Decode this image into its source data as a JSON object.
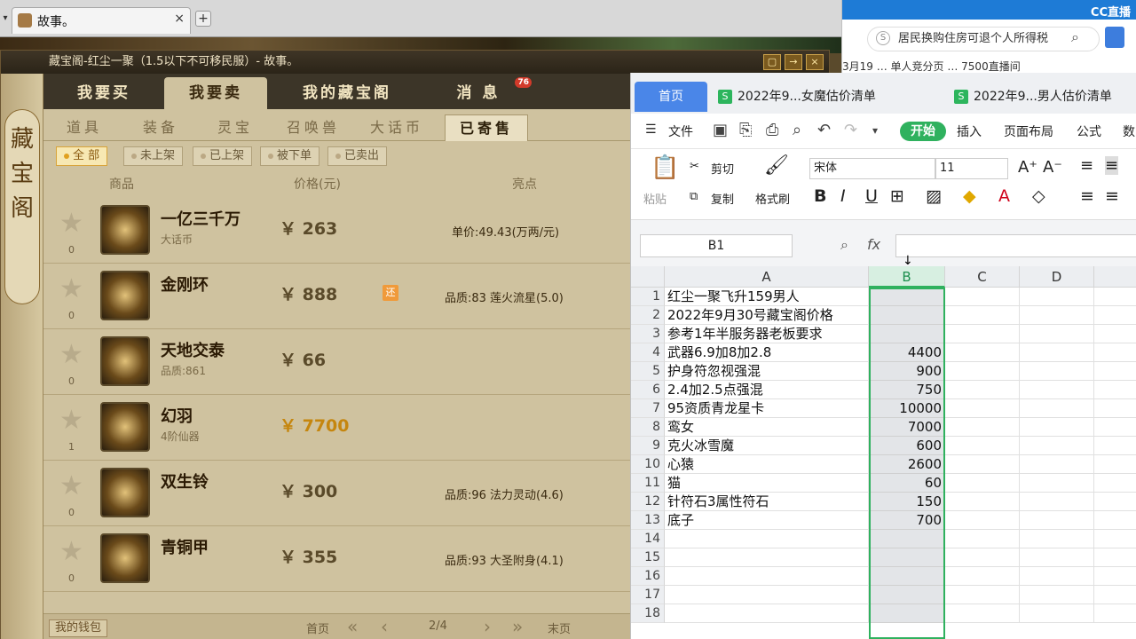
{
  "browser": {
    "tab_title": "故事。",
    "new_tab": "+",
    "close": "×"
  },
  "game": {
    "window_title": "藏宝阁-红尘一聚（1.5以下不可移民服）- 故事。",
    "side_label": "藏宝阁",
    "top_tabs": [
      "我要买",
      "我要卖",
      "我的藏宝阁",
      "消 息"
    ],
    "message_badge": "76",
    "sub_tabs": [
      "道具",
      "装备",
      "灵宝",
      "召唤兽",
      "大话币",
      "已寄售"
    ],
    "filters": [
      "全 部",
      "未上架",
      "已上架",
      "被下单",
      "已卖出"
    ],
    "col_headers": {
      "item": "商品",
      "price": "价格(元)",
      "highlight": "亮点"
    },
    "items": [
      {
        "name": "一亿三千万",
        "sub": "大话币",
        "price": "￥ 263",
        "count": "0",
        "highlight": "单价:49.43(万两/元)",
        "tag": ""
      },
      {
        "name": "金刚环",
        "sub": "",
        "price": "￥ 888",
        "count": "0",
        "highlight": "品质:83 莲火流星(5.0)",
        "tag": "还"
      },
      {
        "name": "天地交泰",
        "sub": "品质:861",
        "price": "￥ 66",
        "count": "0",
        "highlight": "",
        "tag": ""
      },
      {
        "name": "幻羽",
        "sub": "4阶仙器",
        "price": "￥ 7700",
        "count": "1",
        "highlight": "",
        "tag": ""
      },
      {
        "name": "双生铃",
        "sub": "",
        "price": "￥ 300",
        "count": "0",
        "highlight": "品质:96 法力灵动(4.6)",
        "tag": ""
      },
      {
        "name": "青铜甲",
        "sub": "",
        "price": "￥ 355",
        "count": "0",
        "highlight": "品质:93 大圣附身(4.1)",
        "tag": ""
      }
    ],
    "pager": {
      "wallet": "我的钱包",
      "first": "首页",
      "page": "2/4",
      "last": "末页"
    }
  },
  "wps": {
    "tabs": [
      "首页",
      "2022年9...女魔估价清单",
      "2022年9...男人估价清单"
    ],
    "menu": {
      "file": "文件",
      "start": "开始",
      "insert": "插入",
      "layout": "页面布局",
      "formula": "公式",
      "data": "数"
    },
    "ribbon": {
      "paste": "粘贴",
      "cut": "剪切",
      "copy": "复制",
      "format_painter": "格式刷",
      "font": "宋体",
      "size": "11"
    },
    "name_box": "B1",
    "fx": "fx",
    "columns": [
      "A",
      "B",
      "C",
      "D"
    ],
    "rows": [
      {
        "n": "1",
        "a": "红尘一聚飞升159男人",
        "b": ""
      },
      {
        "n": "2",
        "a": "2022年9月30号藏宝阁价格",
        "b": ""
      },
      {
        "n": "3",
        "a": "参考1年半服务器老板要求",
        "b": ""
      },
      {
        "n": "4",
        "a": "武器6.9加8加2.8",
        "b": "4400"
      },
      {
        "n": "5",
        "a": "护身符忽视强混",
        "b": "900"
      },
      {
        "n": "6",
        "a": "2.4加2.5点强混",
        "b": "750"
      },
      {
        "n": "7",
        "a": "95资质青龙星卡",
        "b": "10000"
      },
      {
        "n": "8",
        "a": "鸾女",
        "b": "7000"
      },
      {
        "n": "9",
        "a": "克火冰雪魔",
        "b": "600"
      },
      {
        "n": "10",
        "a": "心猿",
        "b": "2600"
      },
      {
        "n": "11",
        "a": "猫",
        "b": "60"
      },
      {
        "n": "12",
        "a": "针符石3属性符石",
        "b": "150"
      },
      {
        "n": "13",
        "a": "底子",
        "b": "700"
      },
      {
        "n": "14",
        "a": "",
        "b": ""
      },
      {
        "n": "15",
        "a": "",
        "b": ""
      },
      {
        "n": "16",
        "a": "",
        "b": ""
      },
      {
        "n": "17",
        "a": "",
        "b": ""
      },
      {
        "n": "18",
        "a": "",
        "b": ""
      }
    ]
  },
  "right_browser": {
    "logo": "CC直播",
    "search_placeholder": "居民换购住房可退个人所得税",
    "strip_text": "3月19 … 单人竞分页 … 7500直播间"
  }
}
